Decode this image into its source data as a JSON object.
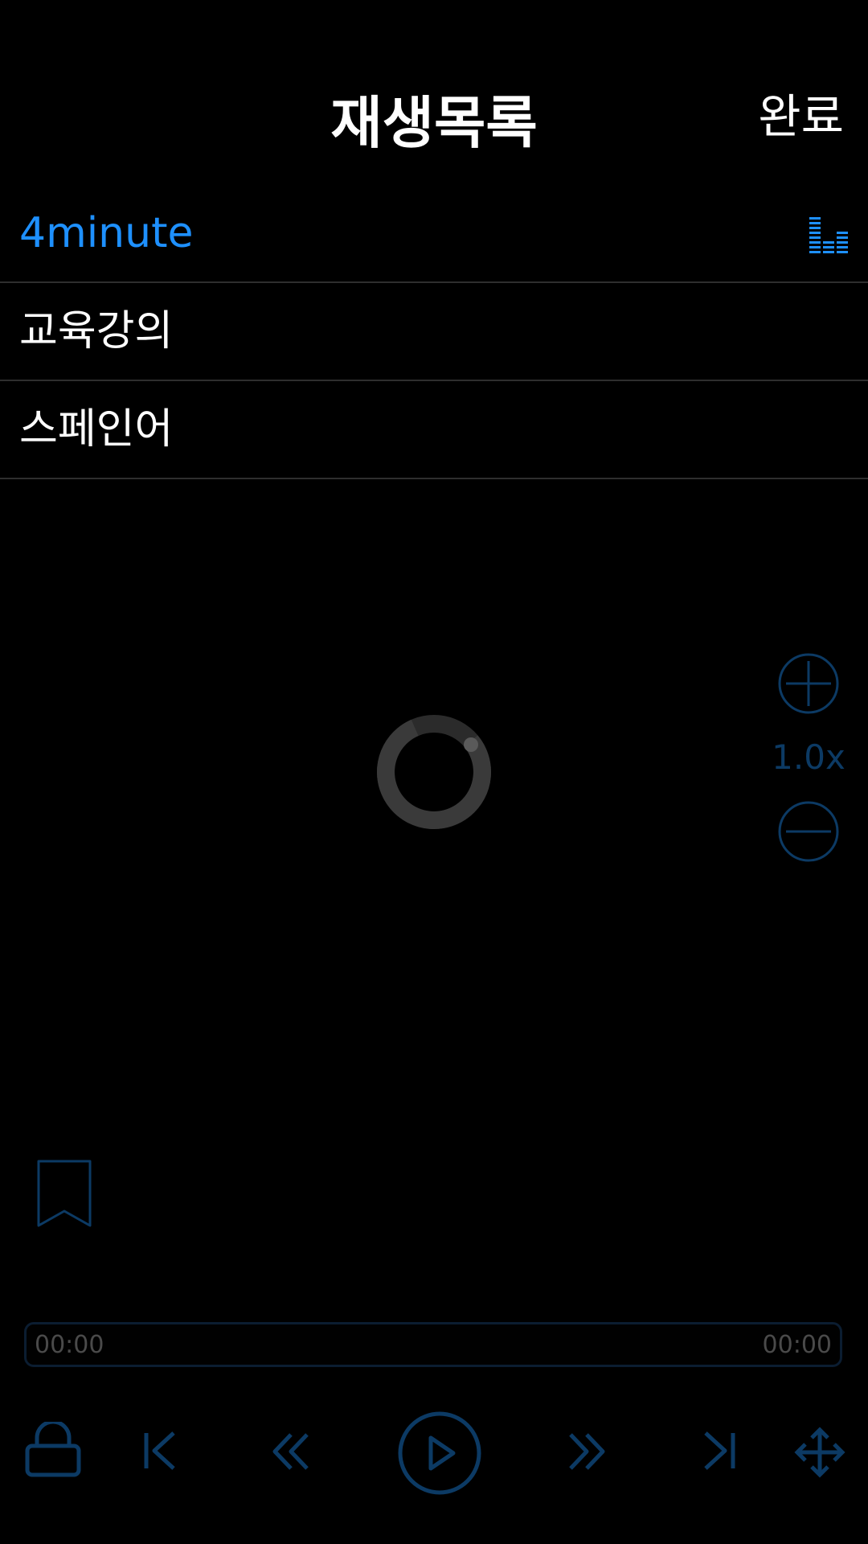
{
  "header": {
    "title": "재생목록",
    "done_label": "완료"
  },
  "playlist": {
    "items": [
      {
        "label": "4minute",
        "active": true,
        "icon": "equalizer-icon"
      },
      {
        "label": "교육강의",
        "active": false
      },
      {
        "label": "스페인어",
        "active": false
      }
    ]
  },
  "speed": {
    "value": "1.0x"
  },
  "progress": {
    "current": "00:00",
    "total": "00:00"
  },
  "controls": [
    "lock-icon",
    "skip-previous-icon",
    "rewind-icon",
    "play-icon",
    "fast-forward-icon",
    "skip-next-icon",
    "move-icon"
  ],
  "colors": {
    "accent": "#1e90ff",
    "control_blue": "#0c3a64",
    "divider": "#2e2e2e",
    "background": "#000000"
  }
}
